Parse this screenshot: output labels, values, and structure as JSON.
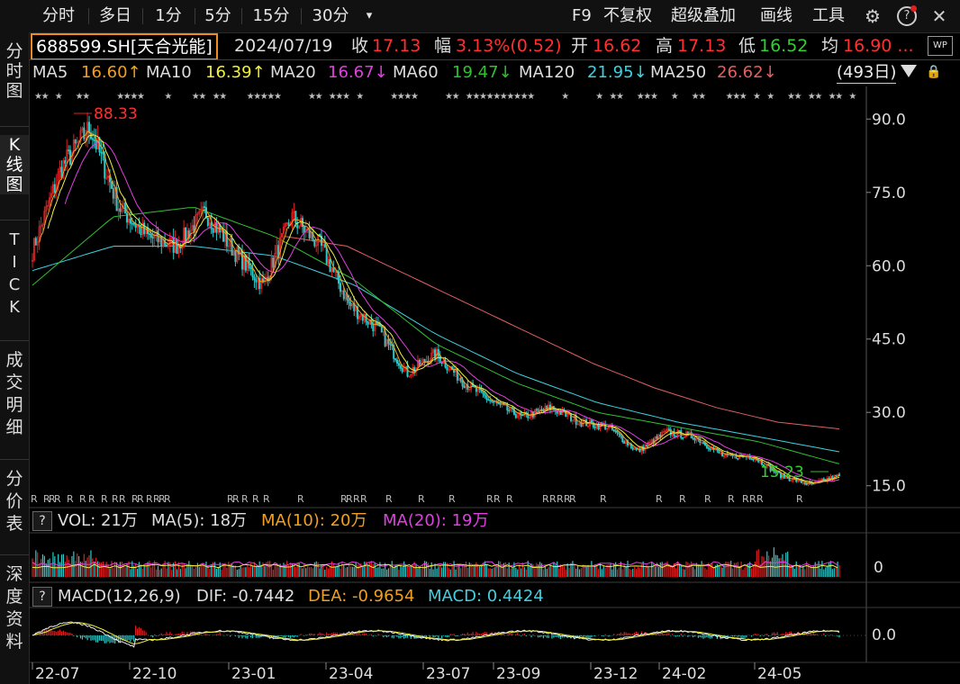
{
  "toolbar": {
    "tabs": [
      "分时",
      "多日",
      "1分",
      "5分",
      "15分",
      "30分"
    ],
    "dropdown": "▾",
    "right": [
      "F9",
      "不复权",
      "超级叠加",
      "画线",
      "工具"
    ]
  },
  "sidebar": {
    "items": [
      {
        "label": "分\n时\n图",
        "active": false
      },
      {
        "label": "K\n线\n图",
        "active": true
      },
      {
        "label": "T\nI\nC\nK",
        "active": false
      },
      {
        "label": "成\n交\n明\n细",
        "active": false
      },
      {
        "label": "分\n价\n表",
        "active": false
      },
      {
        "label": "深\n度\n资\n料",
        "active": false
      }
    ]
  },
  "info": {
    "code": "688599.SH[天合光能]",
    "date": "2024/07/19",
    "close_label": "收",
    "close": "17.13",
    "change_label": "幅",
    "change": "3.13%(0.52)",
    "open_label": "开",
    "open": "16.62",
    "high_label": "高",
    "high": "17.13",
    "low_label": "低",
    "low": "16.52",
    "avg_label": "均",
    "avg": "16.90 ...",
    "wp": "WP"
  },
  "ma": {
    "ma5": {
      "label": "MA5",
      "value": "16.60↑",
      "color": "#f0a020"
    },
    "ma10": {
      "label": "MA10",
      "value": "16.39↑",
      "color": "#f0f040"
    },
    "ma20": {
      "label": "MA20",
      "value": "16.67↓",
      "color": "#e040e0"
    },
    "ma60": {
      "label": "MA60",
      "value": "19.47↓",
      "color": "#30c030"
    },
    "ma120": {
      "label": "MA120",
      "value": "21.95↓",
      "color": "#40d0e0"
    },
    "ma250": {
      "label": "MA250",
      "value": "26.62↓",
      "color": "#e06060"
    },
    "days": "(493日)"
  },
  "price_axis": [
    "90.0",
    "75.0",
    "60.0",
    "45.0",
    "30.0",
    "15.0"
  ],
  "annotations": {
    "high": "88.33",
    "low": "15.23"
  },
  "vol_panel": {
    "label": "VOL: 21万",
    "ma5": "MA(5): 18万",
    "ma10": "MA(10): 20万",
    "ma20": "MA(20): 19万",
    "axis": "0"
  },
  "macd_panel": {
    "label": "MACD(12,26,9)",
    "dif": "DIF: -0.7442",
    "dea": "DEA: -0.9654",
    "macd": "MACD: 0.4424",
    "axis": "0.0"
  },
  "dates": [
    "22-07",
    "22-10",
    "23-01",
    "23-04",
    "23-07",
    "23-09",
    "23-12",
    "24-02",
    "24-05"
  ],
  "colors": {
    "up": "#e02020",
    "down": "#30c8c8",
    "ma5": "#f0a020",
    "ma10": "#f0f040",
    "ma20": "#e040e0",
    "ma60": "#30c030",
    "ma120": "#40d0e0",
    "ma250": "#e06060"
  },
  "chart_data": {
    "type": "candlestick",
    "ylim": [
      12,
      93
    ],
    "price_points": [
      {
        "date": "22-06",
        "close": 63
      },
      {
        "date": "22-07",
        "close": 80
      },
      {
        "date": "22-07",
        "close": 88.33
      },
      {
        "date": "22-08",
        "close": 72
      },
      {
        "date": "22-09",
        "close": 66
      },
      {
        "date": "22-10",
        "close": 64
      },
      {
        "date": "22-10",
        "close": 71
      },
      {
        "date": "22-11",
        "close": 63
      },
      {
        "date": "22-12",
        "close": 56
      },
      {
        "date": "23-01",
        "close": 70
      },
      {
        "date": "23-02",
        "close": 64
      },
      {
        "date": "23-03",
        "close": 52
      },
      {
        "date": "23-04",
        "close": 47
      },
      {
        "date": "23-05",
        "close": 38
      },
      {
        "date": "23-06",
        "close": 42
      },
      {
        "date": "23-07",
        "close": 36
      },
      {
        "date": "23-08",
        "close": 32
      },
      {
        "date": "23-09",
        "close": 29
      },
      {
        "date": "23-10",
        "close": 31
      },
      {
        "date": "23-11",
        "close": 28
      },
      {
        "date": "23-12",
        "close": 27
      },
      {
        "date": "24-01",
        "close": 22
      },
      {
        "date": "24-02",
        "close": 26
      },
      {
        "date": "24-03",
        "close": 25
      },
      {
        "date": "24-04",
        "close": 21
      },
      {
        "date": "24-05",
        "close": 21
      },
      {
        "date": "24-06",
        "close": 17
      },
      {
        "date": "24-07",
        "close": 15.23
      },
      {
        "date": "24-07",
        "close": 17.13
      }
    ],
    "ma250": [
      {
        "date": "22-09",
        "value": 68
      },
      {
        "date": "23-01",
        "value": 66
      },
      {
        "date": "23-07",
        "value": 57
      },
      {
        "date": "24-01",
        "value": 42
      },
      {
        "date": "24-07",
        "value": 26.62
      }
    ],
    "ma120": [
      {
        "date": "22-08",
        "value": 63
      },
      {
        "date": "23-01",
        "value": 63
      },
      {
        "date": "23-07",
        "value": 47
      },
      {
        "date": "24-01",
        "value": 29
      },
      {
        "date": "24-07",
        "value": 21.95
      }
    ],
    "ma60": [
      {
        "date": "22-06",
        "value": 56
      },
      {
        "date": "22-09",
        "value": 73
      },
      {
        "date": "23-01",
        "value": 66
      },
      {
        "date": "23-07",
        "value": 40
      },
      {
        "date": "24-01",
        "value": 27
      },
      {
        "date": "24-07",
        "value": 19.47
      }
    ]
  }
}
